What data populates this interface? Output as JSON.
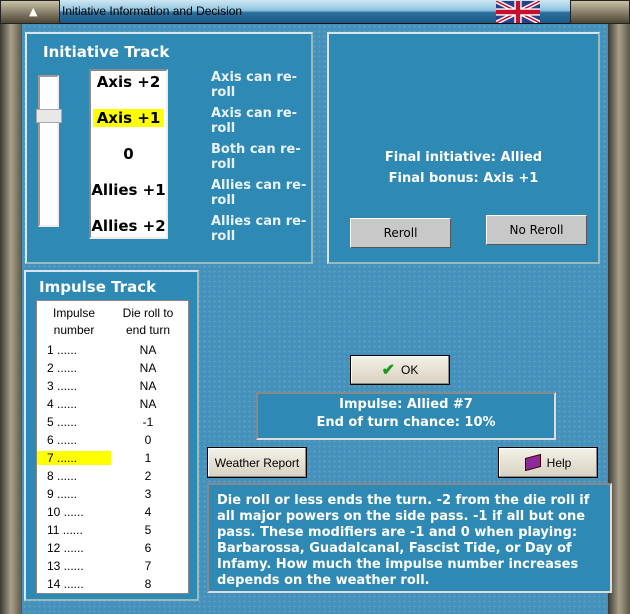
{
  "window": {
    "title": "Initiative Information and Decision"
  },
  "initiative": {
    "title": "Initiative Track",
    "levels": [
      {
        "label": "Axis +2",
        "desc": "Axis can re-roll"
      },
      {
        "label": "Axis +1",
        "desc": "Axis can re-roll"
      },
      {
        "label": "0",
        "desc": "Both can re-roll"
      },
      {
        "label": "Allies +1",
        "desc": "Allies can re-roll"
      },
      {
        "label": "Allies +2",
        "desc": "Allies can re-roll"
      }
    ],
    "tick": "-",
    "selected_index": 1,
    "highlight_color": "#ffff00"
  },
  "result": {
    "final_initiative": "Final initiative: Allied",
    "final_bonus": "Final bonus: Axis +1",
    "reroll": "Reroll",
    "no_reroll": "No Reroll"
  },
  "impulse": {
    "title": "Impulse Track",
    "col1": "Impulse number",
    "col2": "Die roll to end turn",
    "rows": [
      {
        "n": "1 ......",
        "v": "NA"
      },
      {
        "n": "2 ......",
        "v": "NA"
      },
      {
        "n": "3 ......",
        "v": "NA"
      },
      {
        "n": "4 ......",
        "v": "NA"
      },
      {
        "n": "5 ......",
        "v": "-1"
      },
      {
        "n": "6 ......",
        "v": "0"
      },
      {
        "n": "7 ......",
        "v": "1"
      },
      {
        "n": "8 ......",
        "v": "2"
      },
      {
        "n": "9 ......",
        "v": "3"
      },
      {
        "n": "10 ......",
        "v": "4"
      },
      {
        "n": "11 ......",
        "v": "5"
      },
      {
        "n": "12 ......",
        "v": "6"
      },
      {
        "n": "13 ......",
        "v": "7"
      },
      {
        "n": "14 ......",
        "v": "8"
      }
    ],
    "selected_index": 6
  },
  "ok": "OK",
  "status": {
    "impulse": "Impulse: Allied #7",
    "chance": "End of turn chance: 10%"
  },
  "weather": "Weather Report",
  "help": "Help",
  "description": "Die roll or less ends the turn.  -2 from the die roll if all major powers on the side pass.  -1 if all but one pass.  These modifiers are -1 and 0 when playing: Barbarossa, Guadalcanal, Fascist Tide, or Day of Infamy.  How much the impulse number increases depends on the weather roll."
}
